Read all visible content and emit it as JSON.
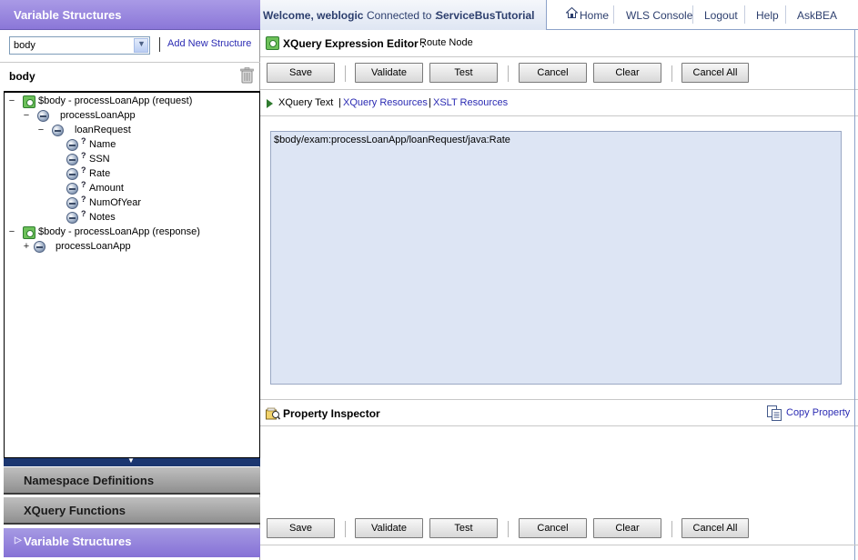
{
  "left": {
    "header": "Variable Structures",
    "select_value": "body",
    "add_link": "Add New Structure",
    "structure_name": "body",
    "tree": [
      {
        "label": "$body - processLoanApp (request)",
        "toggle": "−",
        "icon": "element-green"
      },
      {
        "label": "processLoanApp",
        "toggle": "−",
        "icon": "sequence-ball"
      },
      {
        "label": "loanRequest",
        "toggle": "−",
        "icon": "sequence-ball"
      },
      {
        "label": "Name",
        "toggle": "",
        "icon": "optional-ball"
      },
      {
        "label": "SSN",
        "toggle": "",
        "icon": "optional-ball"
      },
      {
        "label": "Rate",
        "toggle": "",
        "icon": "optional-ball"
      },
      {
        "label": "Amount",
        "toggle": "",
        "icon": "optional-ball"
      },
      {
        "label": "NumOfYear",
        "toggle": "",
        "icon": "optional-ball"
      },
      {
        "label": "Notes",
        "toggle": "",
        "icon": "optional-ball"
      },
      {
        "label": "$body - processLoanApp (response)",
        "toggle": "−",
        "icon": "element-green"
      },
      {
        "label": "processLoanApp",
        "toggle": "+",
        "icon": "sequence-ball"
      }
    ],
    "accordion": {
      "namespace": "Namespace Definitions",
      "functions": "XQuery Functions",
      "variables": "Variable Structures"
    },
    "optional_mark": "?"
  },
  "topnav": {
    "welcome": "Welcome, weblogic",
    "connected_label": "Connected to :",
    "server": "ServiceBusTutorial",
    "links": {
      "home": "Home",
      "wls_console": "WLS Console",
      "logout": "Logout",
      "help": "Help",
      "askbea": "AskBEA"
    }
  },
  "editor": {
    "title": "XQuery Expression Editor :",
    "subtitle": "Route Node",
    "buttons": {
      "save": "Save",
      "validate": "Validate",
      "test": "Test",
      "cancel": "Cancel",
      "clear": "Clear",
      "cancel_all": "Cancel All"
    },
    "tabs": {
      "current": "XQuery Text",
      "resources": "XQuery Resources",
      "xslt": "XSLT Resources",
      "pipe": "|"
    },
    "expression": "$body/exam:processLoanApp/loanRequest/java:Rate"
  },
  "property": {
    "title": "Property Inspector",
    "copy": "Copy Property"
  },
  "colors": {
    "purple_header": "#8b77d8",
    "gray_accordion": "#a8a8a8",
    "link_blue": "#2b2bb3",
    "editor_bg": "#dde5f4"
  }
}
